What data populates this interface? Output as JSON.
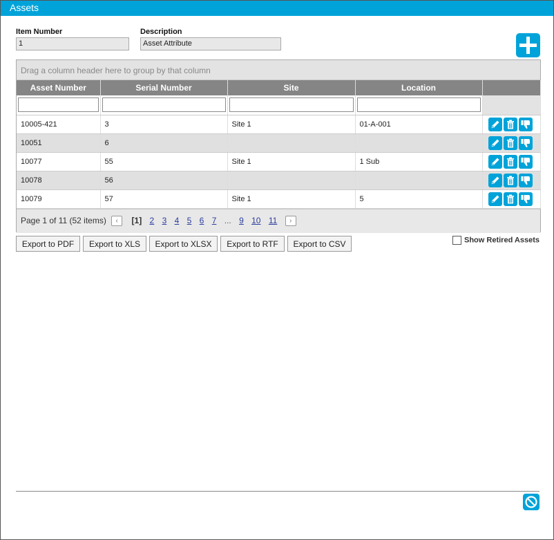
{
  "window": {
    "title": "Assets"
  },
  "form": {
    "item_number_label": "Item Number",
    "item_number_value": "1",
    "description_label": "Description",
    "description_value": "Asset Attribute"
  },
  "icons": {
    "add": "plus-icon",
    "edit": "pencil-icon",
    "delete": "trash-icon",
    "retire": "thumbs-down-icon",
    "cancel": "cancel-icon",
    "prev": "chevron-left-icon",
    "next": "chevron-right-icon"
  },
  "colors": {
    "accent": "#00a3d9",
    "header": "#858585",
    "alt_row": "#e0e0e0"
  },
  "grid": {
    "group_panel_text": "Drag a column header here to group by that column",
    "columns": [
      "Asset Number",
      "Serial Number",
      "Site",
      "Location"
    ],
    "rows": [
      {
        "asset_number": "10005-421",
        "serial_number": "3",
        "site": "Site 1",
        "location": "01-A-001"
      },
      {
        "asset_number": "10051",
        "serial_number": "6",
        "site": "",
        "location": ""
      },
      {
        "asset_number": "10077",
        "serial_number": "55",
        "site": "Site 1",
        "location": "1 Sub"
      },
      {
        "asset_number": "10078",
        "serial_number": "56",
        "site": "",
        "location": ""
      },
      {
        "asset_number": "10079",
        "serial_number": "57",
        "site": "Site 1",
        "location": "5"
      }
    ],
    "pager": {
      "summary": "Page 1 of 11 (52 items)",
      "current": "[1]",
      "pages": [
        "2",
        "3",
        "4",
        "5",
        "6",
        "7"
      ],
      "ellipsis": "...",
      "last_pages": [
        "9",
        "10",
        "11"
      ]
    }
  },
  "export": {
    "pdf": "Export to PDF",
    "xls": "Export to XLS",
    "xlsx": "Export to XLSX",
    "rtf": "Export to RTF",
    "csv": "Export to CSV"
  },
  "show_retired": {
    "label": "Show Retired Assets",
    "checked": false
  }
}
